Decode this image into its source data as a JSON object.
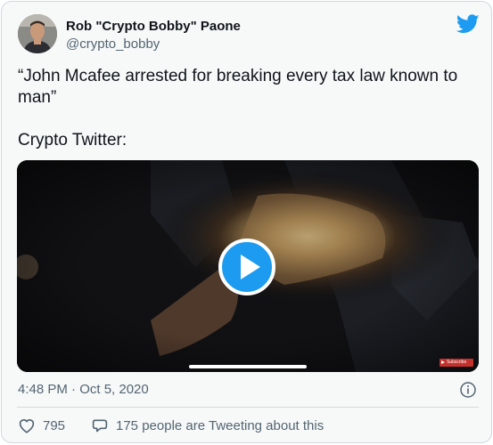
{
  "author": {
    "name": "Rob \"Crypto Bobby\" Paone",
    "handle": "@crypto_bobby"
  },
  "tweet": {
    "lines": [
      "“John Mcafee arrested for breaking every tax law known to",
      "man”",
      "",
      "Crypto Twitter:"
    ]
  },
  "media": {
    "type": "video",
    "badge_text": "Subscribe",
    "play_icon": "play-icon"
  },
  "meta": {
    "timestamp": "4:48 PM · Oct 5, 2020"
  },
  "actions": {
    "like_count": "795",
    "reply_text": "175 people are Tweeting about this"
  },
  "colors": {
    "accent": "#1d9bf0",
    "text": "#0f1419",
    "muted": "#536471",
    "border": "#cfd9de",
    "background": "#f7f9f9"
  }
}
